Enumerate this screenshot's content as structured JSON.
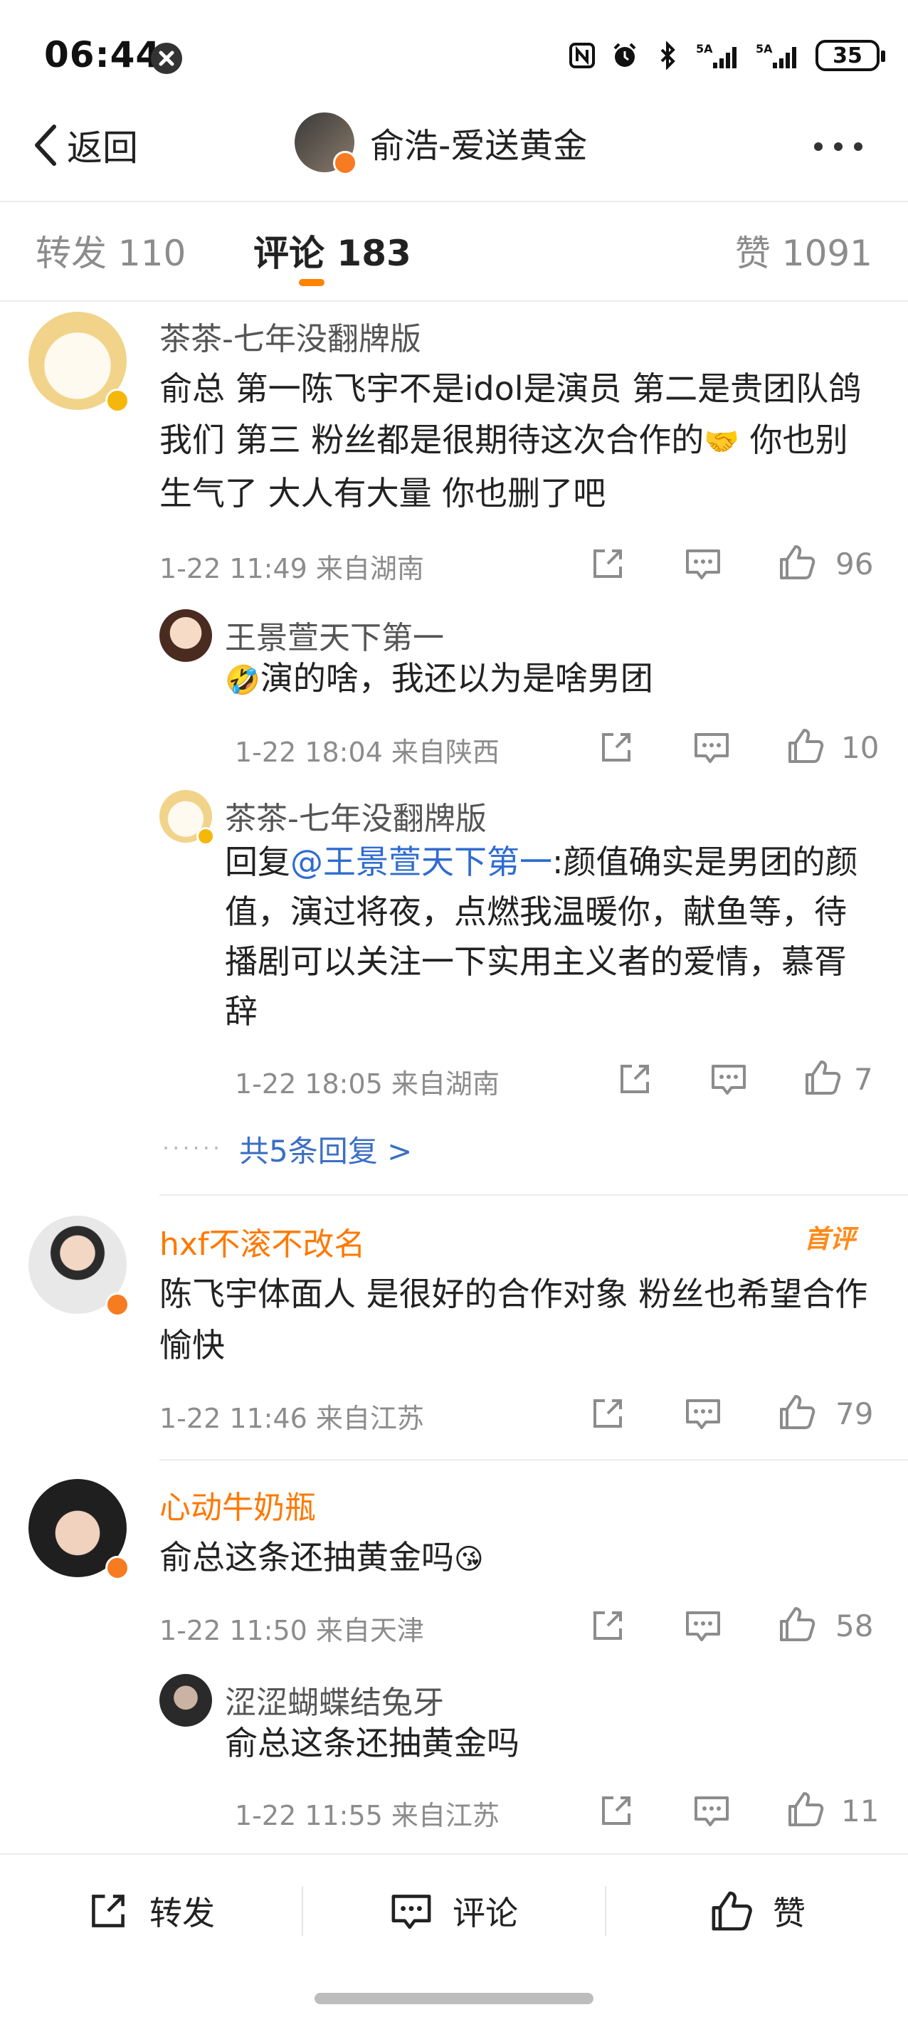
{
  "status_bar": {
    "time": "06:44",
    "battery": "35",
    "icons": [
      "nfc-icon",
      "alarm-icon",
      "bluetooth-icon",
      "signal-5g-icon",
      "signal-5g-icon"
    ]
  },
  "nav": {
    "back_label": "返回",
    "title": "俞浩-爱送黄金"
  },
  "tabs": [
    {
      "label": "转发 110"
    },
    {
      "label": "评论 183"
    },
    {
      "label": "赞 1091"
    }
  ],
  "comments": [
    {
      "user": "茶茶-七年没翻牌版",
      "text": "俞总 第一陈飞宇不是idol是演员 第二是贵团队鸽我们 第三 粉丝都是很期待这次合作的",
      "text_tail": " 你也别生气了 大人有大量 你也删了吧",
      "emoji": "🤝",
      "time": "1-22 11:49 来自湖南",
      "likes": "96",
      "replies": [
        {
          "user": "王景萱天下第一",
          "emoji": "🤣",
          "text": "演的啥，我还以为是啥男团",
          "time": "1-22 18:04 来自陕西",
          "likes": "10"
        },
        {
          "user": "茶茶-七年没翻牌版",
          "prefix": "回复",
          "mention": "@王景萱天下第一",
          "text": ":颜值确实是男团的颜值，演过将夜，点燃我温暖你，献鱼等，待播剧可以关注一下实用主义者的爱情，慕胥辞",
          "time": "1-22 18:05 来自湖南",
          "likes": "7"
        }
      ],
      "more_replies": "共5条回复 >",
      "dots": "······"
    },
    {
      "user": "hxf不滚不改名",
      "badge": "首评",
      "text": "陈飞宇体面人 是很好的合作对象 粉丝也希望合作愉快",
      "time": "1-22 11:46 来自江苏",
      "likes": "79"
    },
    {
      "user": "心动牛奶瓶",
      "text": "俞总这条还抽黄金吗",
      "emoji": "😘",
      "time": "1-22 11:50 来自天津",
      "likes": "58",
      "replies": [
        {
          "user": "涩涩蝴蝶结兔牙",
          "text": "俞总这条还抽黄金吗",
          "time": "1-22 11:55 来自江苏",
          "likes": "11"
        }
      ]
    }
  ],
  "bottom_bar": {
    "repost": "转发",
    "comment": "评论",
    "like": "赞"
  },
  "colors": {
    "accent": "#ff8200",
    "link": "#3a6fc4",
    "mention": "#2f6ccf",
    "vip_name": "#ff7800"
  }
}
